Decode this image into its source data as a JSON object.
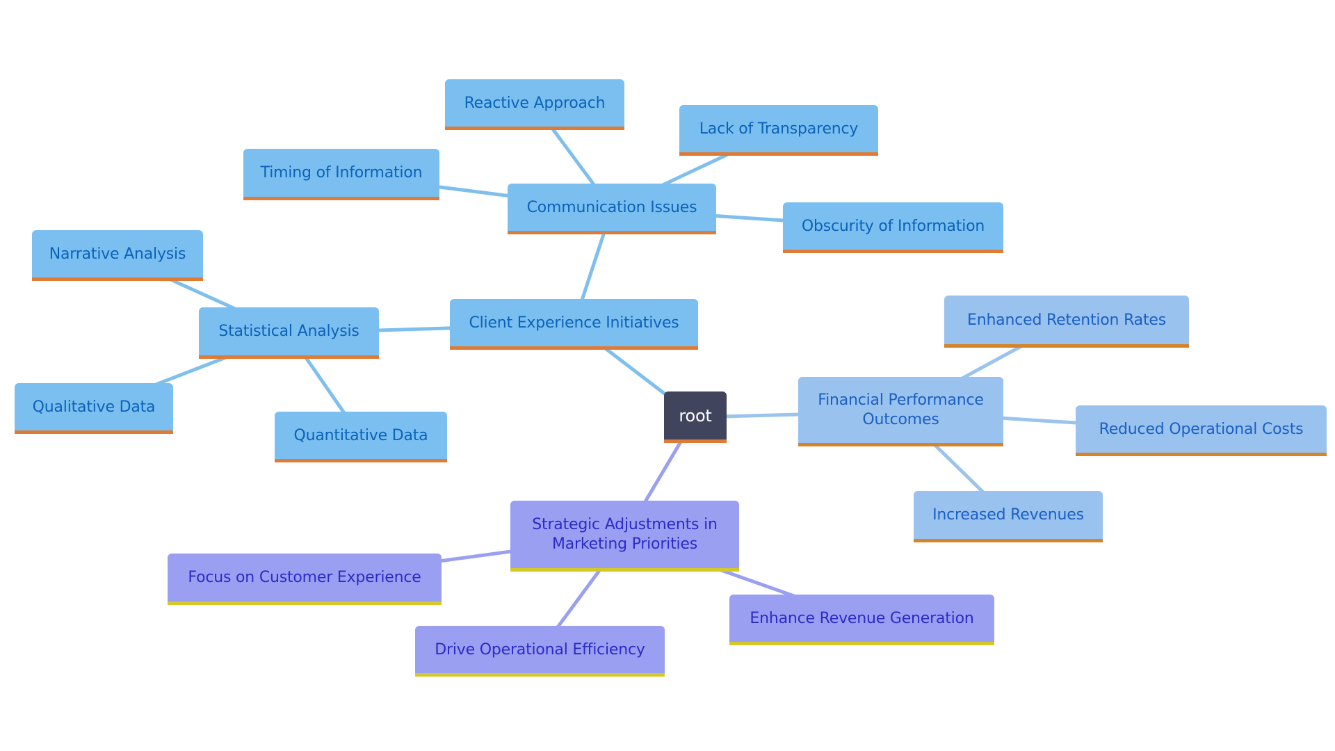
{
  "diagram": {
    "type": "mindmap",
    "colors": {
      "root_fill": "#40445c",
      "root_text": "#ffffff",
      "blue_fill": "#7bbff0",
      "blue_text": "#0c62b8",
      "lightblue_fill": "#9ac2ef",
      "lightblue_text": "#1a5fc2",
      "purple_fill": "#9b9ff2",
      "purple_text": "#2b2bc5",
      "orange_accent": "#e07b35",
      "yellow_accent": "#d4c928",
      "edge_blue": "#7fbfee",
      "edge_lightblue": "#9ac3ee",
      "edge_purple": "#9a9ff2"
    },
    "nodes": {
      "root": {
        "label": "root"
      },
      "client_experience": {
        "label": "Client Experience Initiatives"
      },
      "communication_issues": {
        "label": "Communication Issues"
      },
      "reactive_approach": {
        "label": "Reactive Approach"
      },
      "lack_transparency": {
        "label": "Lack of Transparency"
      },
      "timing_information": {
        "label": "Timing of Information"
      },
      "obscurity_information": {
        "label": "Obscurity of Information"
      },
      "statistical_analysis": {
        "label": "Statistical Analysis"
      },
      "narrative_analysis": {
        "label": "Narrative Analysis"
      },
      "qualitative_data": {
        "label": "Qualitative Data"
      },
      "quantitative_data": {
        "label": "Quantitative Data"
      },
      "financial_performance": {
        "label_line1": "Financial Performance",
        "label_line2": "Outcomes"
      },
      "enhanced_retention": {
        "label": "Enhanced Retention Rates"
      },
      "reduced_costs": {
        "label": "Reduced Operational Costs"
      },
      "increased_revenues": {
        "label": "Increased Revenues"
      },
      "strategic_adjustments": {
        "label_line1": "Strategic Adjustments in",
        "label_line2": "Marketing Priorities"
      },
      "focus_customer": {
        "label": "Focus on Customer Experience"
      },
      "drive_efficiency": {
        "label": "Drive Operational Efficiency"
      },
      "enhance_revenue": {
        "label": "Enhance Revenue Generation"
      }
    },
    "edges": [
      {
        "from": "root",
        "to": "client_experience",
        "color": "edge_blue"
      },
      {
        "from": "client_experience",
        "to": "communication_issues",
        "color": "edge_blue"
      },
      {
        "from": "communication_issues",
        "to": "reactive_approach",
        "color": "edge_blue"
      },
      {
        "from": "communication_issues",
        "to": "lack_transparency",
        "color": "edge_blue"
      },
      {
        "from": "communication_issues",
        "to": "timing_information",
        "color": "edge_blue"
      },
      {
        "from": "communication_issues",
        "to": "obscurity_information",
        "color": "edge_blue"
      },
      {
        "from": "client_experience",
        "to": "statistical_analysis",
        "color": "edge_blue"
      },
      {
        "from": "statistical_analysis",
        "to": "narrative_analysis",
        "color": "edge_blue"
      },
      {
        "from": "statistical_analysis",
        "to": "qualitative_data",
        "color": "edge_blue"
      },
      {
        "from": "statistical_analysis",
        "to": "quantitative_data",
        "color": "edge_blue"
      },
      {
        "from": "root",
        "to": "financial_performance",
        "color": "edge_lightblue"
      },
      {
        "from": "financial_performance",
        "to": "enhanced_retention",
        "color": "edge_lightblue"
      },
      {
        "from": "financial_performance",
        "to": "reduced_costs",
        "color": "edge_lightblue"
      },
      {
        "from": "financial_performance",
        "to": "increased_revenues",
        "color": "edge_lightblue"
      },
      {
        "from": "root",
        "to": "strategic_adjustments",
        "color": "edge_purple"
      },
      {
        "from": "strategic_adjustments",
        "to": "focus_customer",
        "color": "edge_purple"
      },
      {
        "from": "strategic_adjustments",
        "to": "drive_efficiency",
        "color": "edge_purple"
      },
      {
        "from": "strategic_adjustments",
        "to": "enhance_revenue",
        "color": "edge_purple"
      }
    ]
  }
}
